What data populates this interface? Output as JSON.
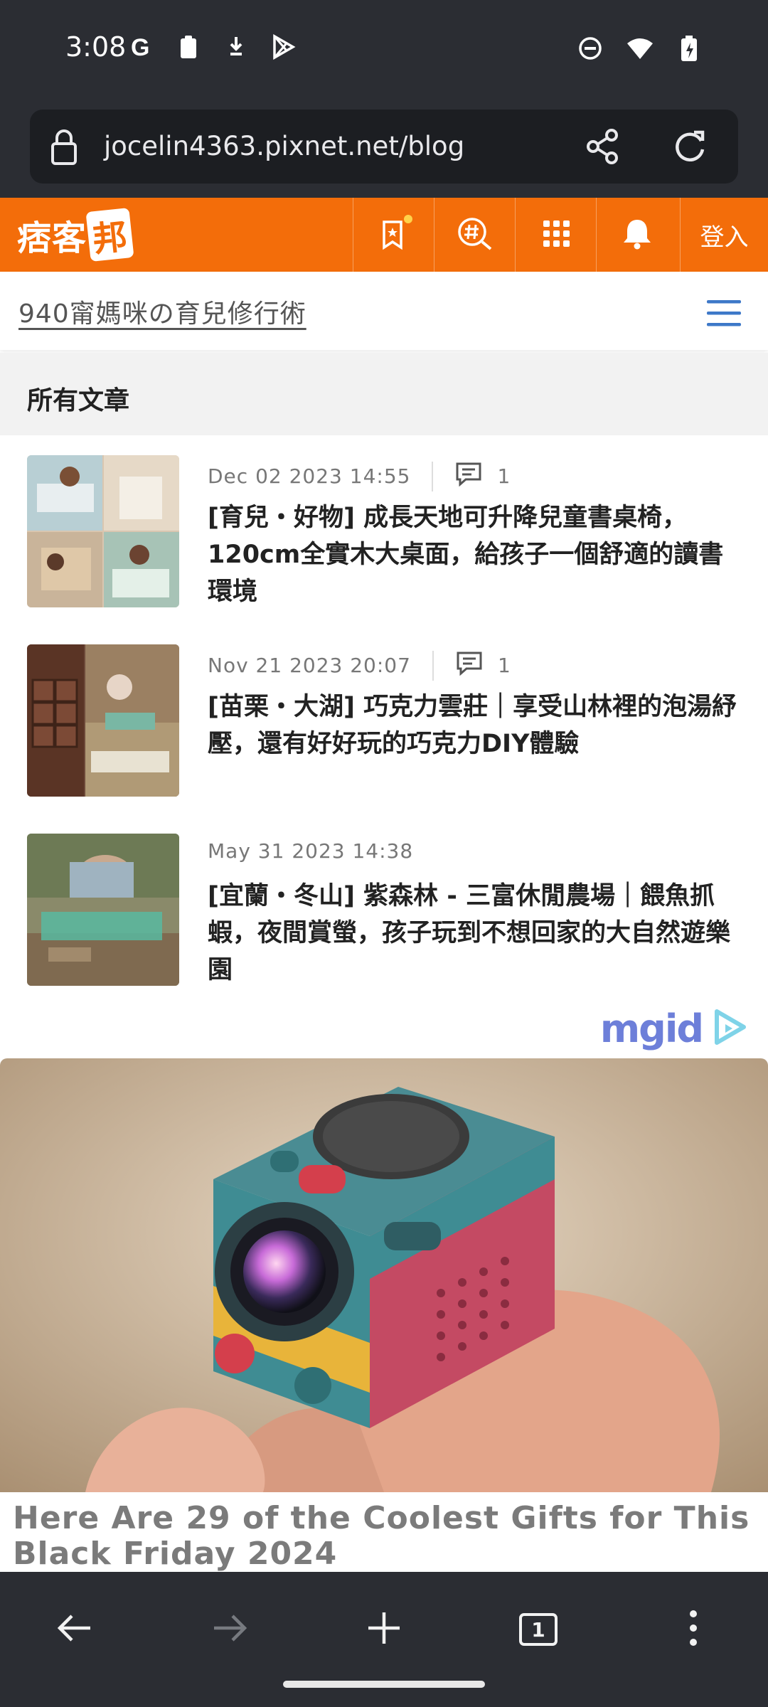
{
  "status_bar": {
    "time": "3:08",
    "left_icons": [
      "google-icon",
      "clipboard-icon",
      "download-icon",
      "play-store-icon"
    ],
    "right_icons": [
      "do-not-disturb-icon",
      "wifi-icon",
      "battery-icon"
    ]
  },
  "browser": {
    "url": "jocelin4363.pixnet.net/blog"
  },
  "site_header": {
    "logo_text": "痞客",
    "logo_box": "邦",
    "buttons": [
      "bookmark-icon",
      "hashtag-search-icon",
      "apps-grid-icon",
      "bell-icon"
    ],
    "login_label": "登入",
    "accent": "#f36d0a"
  },
  "blog": {
    "title": "940甯媽咪の育兒修行術",
    "section_title": "所有文章"
  },
  "articles": [
    {
      "date": "Dec 02 2023 14:55",
      "comments": "1",
      "title": "[育兒・好物] 成長天地可升降兒童書桌椅，120cm全實木大桌面，給孩子一個舒適的讀書環境"
    },
    {
      "date": "Nov 21 2023 20:07",
      "comments": "1",
      "title": "[苗栗・大湖] 巧克力雲莊｜享受山林裡的泡湯紓壓，還有好好玩的巧克力DIY體驗"
    },
    {
      "date": "May 31 2023 14:38",
      "title": "[宜蘭・冬山] 紫森林 - 三富休閒農場｜餵魚抓蝦，夜間賞螢，孩子玩到不想回家的大自然遊樂園"
    }
  ],
  "ad": {
    "provider": "mgid",
    "title": "Here Are 29 of the Coolest Gifts for This Black Friday 2024"
  },
  "bottom_nav": {
    "tab_count": "1",
    "items": [
      "back-icon",
      "forward-icon",
      "new-tab-icon",
      "tab-switcher-icon",
      "more-menu-icon"
    ]
  }
}
